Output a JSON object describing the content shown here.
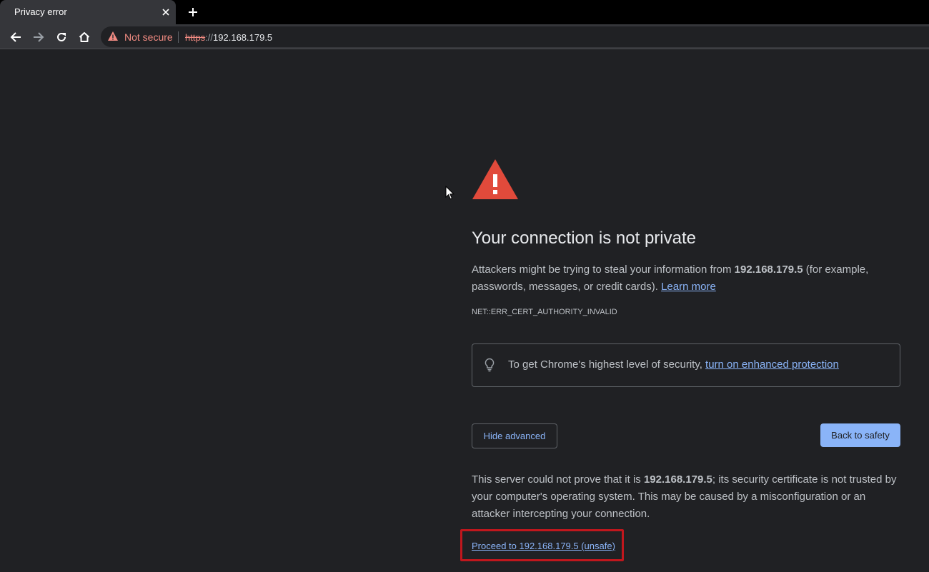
{
  "tab": {
    "title": "Privacy error"
  },
  "toolbar": {
    "security_label": "Not secure",
    "url_scheme": "https",
    "url_scheme_sep": "://",
    "url_host": "192.168.179.5"
  },
  "interstitial": {
    "heading": "Your connection is not private",
    "explanation_prefix": "Attackers might be trying to steal your information from ",
    "explanation_host": "192.168.179.5",
    "explanation_suffix": " (for example, passwords, messages, or credit cards). ",
    "learn_more": "Learn more",
    "error_code": "NET::ERR_CERT_AUTHORITY_INVALID",
    "enhanced_prefix": "To get Chrome's highest level of security, ",
    "enhanced_link": "turn on enhanced protection",
    "hide_advanced": "Hide advanced",
    "back_to_safety": "Back to safety",
    "details_prefix": "This server could not prove that it is ",
    "details_host": "192.168.179.5",
    "details_suffix": "; its security certificate is not trusted by your computer's operating system. This may be caused by a misconfiguration or an attacker intercepting your connection.",
    "proceed_link": "Proceed to 192.168.179.5 (unsafe)"
  },
  "colors": {
    "page_background": "#202124",
    "danger_red": "#e14a3b",
    "link_blue": "#8ab4f8",
    "highlight_red": "#c0171d",
    "not_secure_red": "#f28b82"
  },
  "icons": {
    "tab_close": "close-icon",
    "new_tab": "plus-icon",
    "back": "arrow-left-icon",
    "forward": "arrow-right-icon",
    "reload": "reload-icon",
    "home": "home-icon",
    "security": "warning-triangle-icon",
    "danger": "danger-triangle-icon",
    "tip": "lightbulb-icon"
  }
}
